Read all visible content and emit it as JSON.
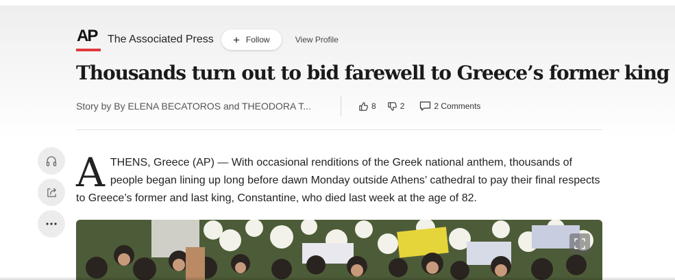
{
  "header": {
    "logo_text": "AP",
    "publisher": "The Associated Press",
    "follow_label": "Follow",
    "view_profile_label": "View Profile"
  },
  "article": {
    "title": "Thousands turn out to bid farewell to Greece’s former king",
    "byline": "Story by By ELENA BECATOROS and THEODORA T...",
    "likes": "8",
    "dislikes": "2",
    "comments": "2 Comments",
    "dropcap": "A",
    "body": "THENS, Greece (AP) — With occasional renditions of the Greek national anthem, thousands of people began lining up long before dawn Monday outside Athens’ cathedral to pay their final respects to Greece’s former and last king, Constantine, who died last week at the age of 82."
  },
  "side_actions": [
    {
      "icon": "headphones-icon"
    },
    {
      "icon": "share-icon"
    },
    {
      "icon": "more-icon"
    }
  ],
  "colors": {
    "brand_red": "#e03a3e",
    "background": "#f3f3f3"
  }
}
